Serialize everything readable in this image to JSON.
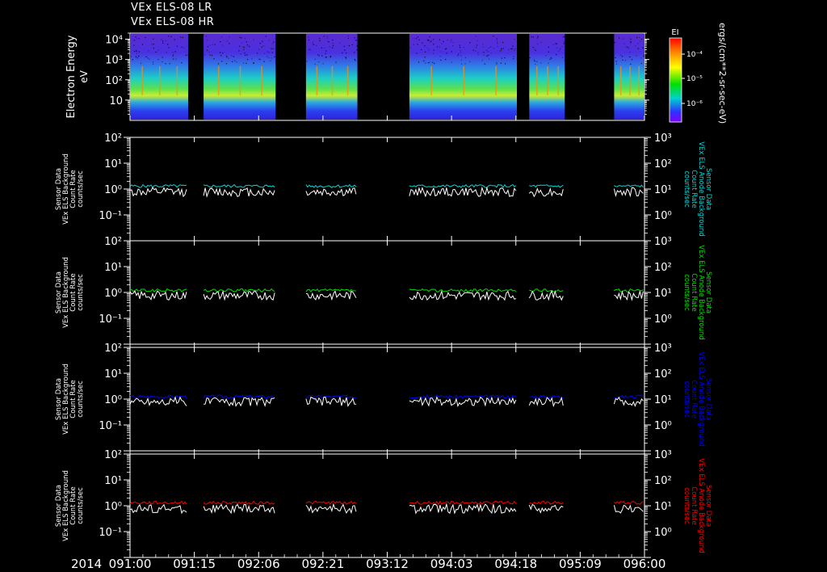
{
  "header": {
    "line1": "VEx ELS-08 LR",
    "line2": "VEx ELS-08 HR"
  },
  "colors": {
    "background": "#000000",
    "axes": "#ffffff",
    "panel1_series": "#00d8d8",
    "panel2_series": "#00e000",
    "panel3_series": "#0000ff",
    "panel4_series": "#ff0000",
    "reference_series": "#ffffff"
  },
  "chart_data": [
    {
      "type": "heatmap",
      "ylabel": "Electron Energy",
      "yunit": "eV",
      "yscale": "log",
      "ylim": [
        1,
        20000
      ],
      "yticks": [
        "10",
        "10²",
        "10³",
        "10⁴"
      ],
      "colorbar": {
        "label": "EI",
        "unit": "ergs/(cm**2-sr-sec-eV)",
        "ticks": [
          "10⁻⁴",
          "10⁻⁵",
          "10⁻⁶"
        ]
      },
      "data_segments": [
        [
          0,
          0.113
        ],
        [
          0.143,
          0.283
        ],
        [
          0.342,
          0.442
        ],
        [
          0.543,
          0.752
        ],
        [
          0.776,
          0.845
        ],
        [
          0.941,
          1.0
        ]
      ]
    },
    {
      "type": "line",
      "ylabel_left": [
        "VEx ELS Background",
        "Count Rate",
        "counts/sec"
      ],
      "sensor_label": "Sensor Data",
      "ylabel_right": [
        "VEx ELS Anode Background",
        "Count Rate",
        "counts/sec"
      ],
      "yscale": "log",
      "ylim_left": [
        0.01,
        100
      ],
      "ylim_right": [
        0.1,
        1000
      ],
      "left_ticks": [
        "10²",
        "10¹",
        "10⁰",
        "10⁻¹"
      ],
      "right_ticks": [
        "10³",
        "10²",
        "10¹",
        "10⁰"
      ],
      "series": [
        {
          "name": "",
          "colorKey": "panel1_series",
          "level": 1.3
        },
        {
          "name": "",
          "colorKey": "reference_series",
          "level": 0.9
        }
      ]
    },
    {
      "type": "line",
      "ylabel_left": [
        "VEx ELS Background",
        "Count Rate",
        "counts/sec"
      ],
      "sensor_label": "Sensor Data",
      "ylabel_right": [
        "VEx ELS Anode Background",
        "Count Rate",
        "counts/sec"
      ],
      "yscale": "log",
      "ylim_left": [
        0.01,
        100
      ],
      "ylim_right": [
        0.1,
        1000
      ],
      "left_ticks": [
        "10²",
        "10¹",
        "10⁰",
        "10⁻¹"
      ],
      "right_ticks": [
        "10³",
        "10²",
        "10¹",
        "10⁰"
      ],
      "series": [
        {
          "name": "",
          "colorKey": "panel2_series",
          "level": 1.2
        },
        {
          "name": "",
          "colorKey": "reference_series",
          "level": 0.9
        }
      ]
    },
    {
      "type": "line",
      "ylabel_left": [
        "VEx ELS Background",
        "Count Rate",
        "counts/sec"
      ],
      "sensor_label": "Sensor Data",
      "ylabel_right": [
        "VEx ELS Anode Background",
        "Count Rate",
        "counts/sec"
      ],
      "yscale": "log",
      "ylim_left": [
        0.01,
        100
      ],
      "ylim_right": [
        0.1,
        1000
      ],
      "left_ticks": [
        "10²",
        "10¹",
        "10⁰",
        "10⁻¹"
      ],
      "right_ticks": [
        "10³",
        "10²",
        "10¹",
        "10⁰"
      ],
      "series": [
        {
          "name": "",
          "colorKey": "panel3_series",
          "level": 1.25
        },
        {
          "name": "",
          "colorKey": "reference_series",
          "level": 0.95
        }
      ]
    },
    {
      "type": "line",
      "ylabel_left": [
        "VEx ELS Background",
        "Count Rate",
        "counts/sec"
      ],
      "sensor_label": "Sensor Data",
      "ylabel_right": [
        "VEx ELS Anode Background",
        "Count Rate",
        "counts/sec"
      ],
      "yscale": "log",
      "ylim_left": [
        0.01,
        100
      ],
      "ylim_right": [
        0.1,
        1000
      ],
      "left_ticks": [
        "10²",
        "10¹",
        "10⁰",
        "10⁻¹"
      ],
      "right_ticks": [
        "10³",
        "10²",
        "10¹",
        "10⁰"
      ],
      "series": [
        {
          "name": "",
          "colorKey": "panel4_series",
          "level": 1.3
        },
        {
          "name": "",
          "colorKey": "reference_series",
          "level": 0.9
        }
      ]
    }
  ],
  "time_axis": {
    "year": "2014",
    "ticks": [
      "091:00",
      "091:15",
      "092:06",
      "092:21",
      "093:12",
      "094:03",
      "094:18",
      "095:09",
      "096:00"
    ]
  }
}
